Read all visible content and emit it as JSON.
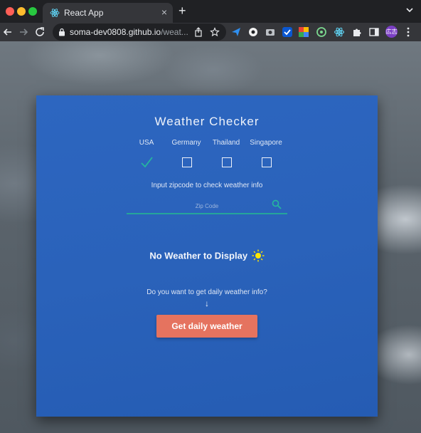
{
  "browser": {
    "tab_title": "React App",
    "tab_close": "×",
    "new_tab": "+",
    "url_host": "soma-dev0808.github.io",
    "url_path": "/weat...",
    "profile_initials": "広志",
    "icons": [
      "back-icon",
      "forward-icon",
      "reload-icon",
      "lock-icon",
      "share-icon",
      "bookmark-star-icon",
      "extensions-puzzle-icon",
      "sidebar-icon",
      "kebab-menu-icon"
    ]
  },
  "app": {
    "title": "Weather Checker",
    "countries": [
      {
        "label": "USA",
        "checked": true
      },
      {
        "label": "Germany",
        "checked": false
      },
      {
        "label": "Thailand",
        "checked": false
      },
      {
        "label": "Singapore",
        "checked": false
      }
    ],
    "zip_prompt": "Input zipcode to check weather info",
    "zip_placeholder": "Zip Code",
    "no_weather": "No Weather to Display",
    "daily_question": "Do you want to get daily weather info?",
    "arrow": "↓",
    "daily_button": "Get daily weather"
  },
  "colors": {
    "card": "#2a62ba",
    "accent_teal": "#25a59a",
    "button": "#e5735f",
    "sun": "#ffe600"
  }
}
